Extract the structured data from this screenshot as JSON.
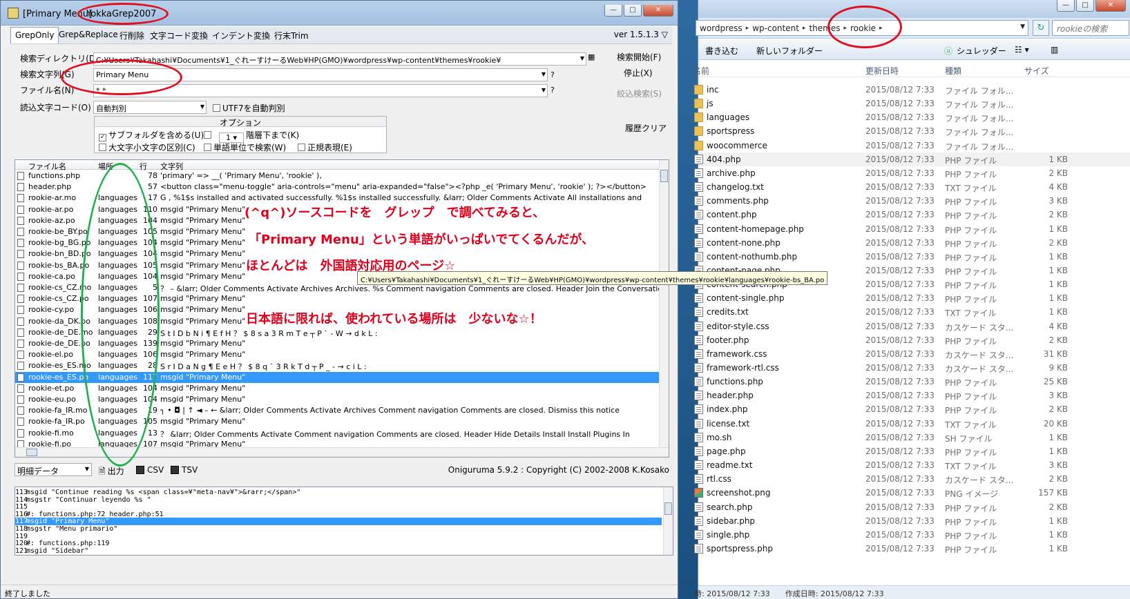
{
  "grep": {
    "title_prefix": "[Primary Menu]",
    "title_app": "YokkaGrep2007",
    "tabs": [
      "GrepOnly",
      "Grep&Replace",
      "行削除",
      "文字コード変換",
      "インデント変換",
      "行末Trim"
    ],
    "version": "ver 1.5.1.3",
    "form": {
      "dir_label": "検索ディレクトリ(D)",
      "dir_value": "C:¥Users¥Takahashi¥Documents¥1_ぐれーすけーるWeb¥HP(GMO)¥wordpress¥wp-content¥themes¥rookie¥",
      "search_label": "検索文字列(G)",
      "search_value": "Primary Menu",
      "file_label": "ファイル名(N)",
      "file_value": "*.*",
      "encoding_label": "読込文字コード(O)",
      "encoding_value": "自動判別",
      "utf7_label": "UTF7を自動判別",
      "qmark": "?"
    },
    "buttons": {
      "start": "検索開始(F)",
      "stop": "停止(X)",
      "narrow": "絞込検索(S)",
      "clear": "履歴クリア"
    },
    "options": {
      "header": "オプション",
      "subfolder": "サブフォルダを含める(U)",
      "depth_value": "1",
      "depth_label": "階層下まで(K)",
      "case": "大文字小文字の区別(C)",
      "word": "単語単位で検索(W)",
      "regex": "正規表現(E)"
    },
    "results": {
      "columns": [
        "ファイル名",
        "場所",
        "行",
        "文字列"
      ],
      "rows": [
        [
          "functions.php",
          "",
          "78",
          "'primary' => __( 'Primary Menu', 'rookie' ),"
        ],
        [
          "header.php",
          "",
          "57",
          "<button class=\"menu-toggle\" aria-controls=\"menu\" aria-expanded=\"false\"><?php _e( 'Primary Menu', 'rookie' ); ?></button>"
        ],
        [
          "rookie-ar.mo",
          "languages",
          "17",
          "G      ,  %1$s installed and activated successfully. %1$s installed successfully. &larr; Older Comments Activate All installations and"
        ],
        [
          "rookie-ar.po",
          "languages",
          "110",
          "msgid \"Primary Menu\""
        ],
        [
          "rookie-az.po",
          "languages",
          "104",
          "msgid \"Primary Menu\""
        ],
        [
          "rookie-be_BY.po",
          "languages",
          "105",
          "msgid \"Primary Menu\""
        ],
        [
          "rookie-bg_BG.po",
          "languages",
          "104",
          "msgid \"Primary Menu\""
        ],
        [
          "rookie-bn_BD.po",
          "languages",
          "104",
          "msgid \"Primary Menu\""
        ],
        [
          "rookie-bs_BA.po",
          "languages",
          "105",
          "msgid \"Primary Menu\""
        ],
        [
          "rookie-ca.po",
          "languages",
          "104",
          "msgid \"Primary Menu\""
        ],
        [
          "rookie-cs_CZ.mo",
          "languages",
          "5",
          "  ？  –  &larr; Older Comments Activate Archives Archives. %s Comment navigation Comments are closed. Header Join the Conversatio"
        ],
        [
          "rookie-cs_CZ.po",
          "languages",
          "107",
          "msgid \"Primary Menu\""
        ],
        [
          "rookie-cy.po",
          "languages",
          "106",
          "msgid \"Primary Menu\""
        ],
        [
          "rookie-da_DK.po",
          "languages",
          "108",
          "msgid \"Primary Menu\""
        ],
        [
          "rookie-de_DE.mo",
          "languages",
          "29",
          "S t I    D b N i ¶ E   f H ？ $   8 s a   3   R m T e ┬    P ` - W   →   d k L :"
        ],
        [
          "rookie-de_DE.po",
          "languages",
          "139",
          "msgid \"Primary Menu\""
        ],
        [
          "rookie-el.po",
          "languages",
          "106",
          "msgid \"Primary Menu\""
        ],
        [
          "rookie-es_ES.mo",
          "languages",
          "28",
          "S r I    D a N g ¶ E   e H ？ $   8 q `   3   R k T d ┬    P _ -   →   c i L :"
        ],
        [
          "rookie-es_ES.po",
          "languages",
          "117",
          "msgid \"Primary Menu\""
        ],
        [
          "rookie-et.po",
          "languages",
          "104",
          "msgid \"Primary Menu\""
        ],
        [
          "rookie-eu.po",
          "languages",
          "104",
          "msgid \"Primary Menu\""
        ],
        [
          "rookie-fa_IR.mo",
          "languages",
          "19",
          "  ┐ •  ◘  |  ↑  ◄  –  ←   &larr; Older Comments Activate Archives Comment navigation Comments are closed. Dismiss this notice"
        ],
        [
          "rookie-fa_IR.po",
          "languages",
          "105",
          "msgid \"Primary Menu\""
        ],
        [
          "rookie-fi.mo",
          "languages",
          "13",
          "  ？  &larr; Older Comments Activate Comment navigation Comments are closed. Header Hide Details Install Install Plugins In"
        ],
        [
          "rookie-fi.po",
          "languages",
          "107",
          "msgid \"Primary Menu\""
        ]
      ]
    },
    "tooltip": "C:¥Users¥Takahashi¥Documents¥1_ぐれーすけーるWeb¥HP(GMO)¥wordpress¥wp-content¥themes¥rookie¥languages¥rookie-bs_BA.po",
    "bottom": {
      "view": "明細データ",
      "out": "出力",
      "csv": "CSV",
      "tsv": "TSV",
      "copyright": "Oniguruma 5.9.2 : Copyright (C) 2002-2008 K.Kosako"
    },
    "detail_lines": [
      [
        "113",
        "msgid \"Continue reading %s <span class=¥\"meta-nav¥\">&rarr;</span>\""
      ],
      [
        "114",
        "msgstr \"Continuar leyendo %s \""
      ],
      [
        "115",
        ""
      ],
      [
        "116",
        "#: functions.php:72 header.php:51"
      ],
      [
        "117",
        "msgid \"Primary Menu\""
      ],
      [
        "118",
        "msgstr \"Menu primario\""
      ],
      [
        "119",
        ""
      ],
      [
        "120",
        "#: functions.php:119"
      ],
      [
        "121",
        "msgid \"Sidebar\""
      ]
    ],
    "status": "終了しました"
  },
  "annotations": [
    "(^q^)ソースコードを　グレップ　で調べてみると、",
    "「Primary Menu」という単語がいっぱいでてくるんだが、",
    "ほとんどは　外国語対応用のページ☆",
    "日本語に限れば、使われている場所は　少ないな☆！"
  ],
  "explorer": {
    "breadcrumbs": [
      "wordpress",
      "wp-content",
      "themes",
      "rookie"
    ],
    "search_placeholder": "rookieの検索",
    "cmd": {
      "organize": "書き込む",
      "new_folder": "新しいフォルダー",
      "shredder": "シュレッダー"
    },
    "columns": {
      "name": "名前",
      "date": "更新日時",
      "type": "種類",
      "size": "サイズ"
    },
    "files": [
      [
        "inc",
        "2015/08/12 7:33",
        "ファイル フォル...",
        "",
        "folder"
      ],
      [
        "js",
        "2015/08/12 7:33",
        "ファイル フォル...",
        "",
        "folder"
      ],
      [
        "languages",
        "2015/08/12 7:33",
        "ファイル フォル...",
        "",
        "folder"
      ],
      [
        "sportspress",
        "2015/08/12 7:33",
        "ファイル フォル...",
        "",
        "folder"
      ],
      [
        "woocommerce",
        "2015/08/12 7:33",
        "ファイル フォル...",
        "",
        "folder"
      ],
      [
        "404.php",
        "2015/08/12 7:33",
        "PHP ファイル",
        "1 KB",
        "file"
      ],
      [
        "archive.php",
        "2015/08/12 7:33",
        "PHP ファイル",
        "2 KB",
        "file"
      ],
      [
        "changelog.txt",
        "2015/08/12 7:33",
        "TXT ファイル",
        "4 KB",
        "file"
      ],
      [
        "comments.php",
        "2015/08/12 7:33",
        "PHP ファイル",
        "3 KB",
        "file"
      ],
      [
        "content.php",
        "2015/08/12 7:33",
        "PHP ファイル",
        "2 KB",
        "file"
      ],
      [
        "content-homepage.php",
        "2015/08/12 7:33",
        "PHP ファイル",
        "1 KB",
        "file"
      ],
      [
        "content-none.php",
        "2015/08/12 7:33",
        "PHP ファイル",
        "2 KB",
        "file"
      ],
      [
        "content-nothumb.php",
        "2015/08/12 7:33",
        "PHP ファイル",
        "1 KB",
        "file"
      ],
      [
        "content-page.php",
        "2015/08/12 7:33",
        "PHP ファイル",
        "1 KB",
        "file"
      ],
      [
        "content-search.php",
        "2015/08/12 7:33",
        "PHP ファイル",
        "1 KB",
        "file"
      ],
      [
        "content-single.php",
        "2015/08/12 7:33",
        "PHP ファイル",
        "1 KB",
        "file"
      ],
      [
        "credits.txt",
        "2015/08/12 7:33",
        "TXT ファイル",
        "1 KB",
        "file"
      ],
      [
        "editor-style.css",
        "2015/08/12 7:33",
        "カスケード スタ...",
        "4 KB",
        "file"
      ],
      [
        "footer.php",
        "2015/08/12 7:33",
        "PHP ファイル",
        "2 KB",
        "file"
      ],
      [
        "framework.css",
        "2015/08/12 7:33",
        "カスケード スタ...",
        "31 KB",
        "file"
      ],
      [
        "framework-rtl.css",
        "2015/08/12 7:33",
        "カスケード スタ...",
        "9 KB",
        "file"
      ],
      [
        "functions.php",
        "2015/08/12 7:33",
        "PHP ファイル",
        "25 KB",
        "file"
      ],
      [
        "header.php",
        "2015/08/12 7:33",
        "PHP ファイル",
        "3 KB",
        "file"
      ],
      [
        "index.php",
        "2015/08/12 7:33",
        "PHP ファイル",
        "2 KB",
        "file"
      ],
      [
        "license.txt",
        "2015/08/12 7:33",
        "TXT ファイル",
        "20 KB",
        "file"
      ],
      [
        "mo.sh",
        "2015/08/12 7:33",
        "SH ファイル",
        "1 KB",
        "file"
      ],
      [
        "page.php",
        "2015/08/12 7:33",
        "PHP ファイル",
        "1 KB",
        "file"
      ],
      [
        "readme.txt",
        "2015/08/12 7:33",
        "TXT ファイル",
        "3 KB",
        "file"
      ],
      [
        "rtl.css",
        "2015/08/12 7:33",
        "カスケード スタ...",
        "2 KB",
        "file"
      ],
      [
        "screenshot.png",
        "2015/08/12 7:33",
        "PNG イメージ",
        "157 KB",
        "img"
      ],
      [
        "search.php",
        "2015/08/12 7:33",
        "PHP ファイル",
        "2 KB",
        "file"
      ],
      [
        "sidebar.php",
        "2015/08/12 7:33",
        "PHP ファイル",
        "1 KB",
        "file"
      ],
      [
        "single.php",
        "2015/08/12 7:33",
        "PHP ファイル",
        "1 KB",
        "file"
      ],
      [
        "sportspress.php",
        "2015/08/12 7:33",
        "PHP ファイル",
        "1 KB",
        "file"
      ]
    ],
    "status": "時: 2015/08/12 7:33　　作成日時: 2015/08/12 7:33"
  }
}
